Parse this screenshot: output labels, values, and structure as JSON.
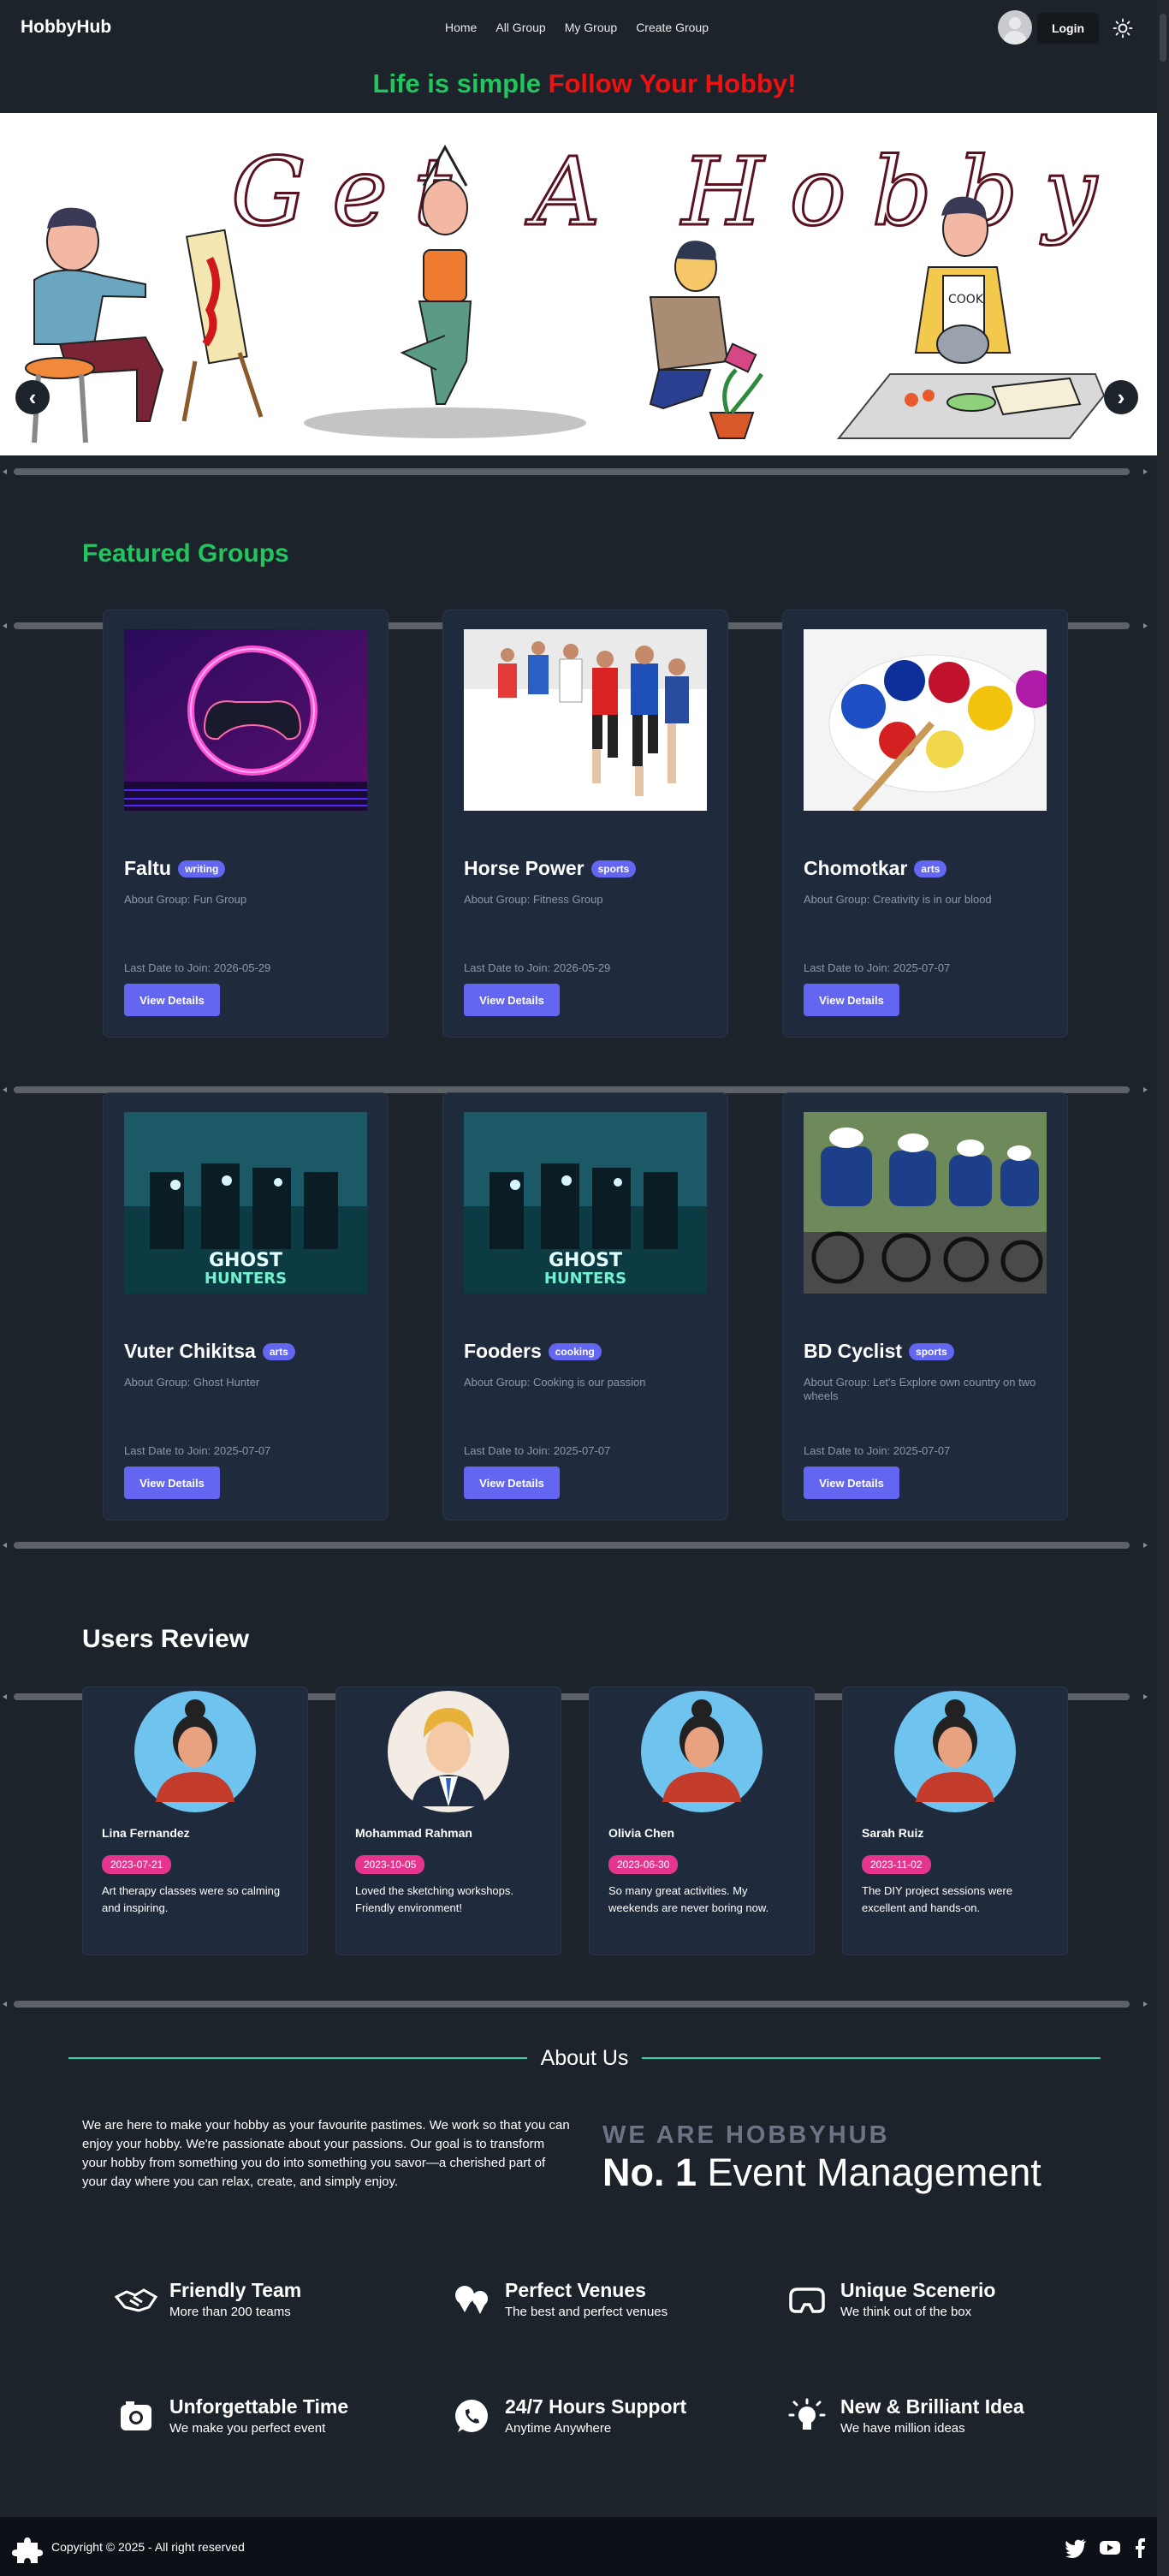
{
  "navbar": {
    "brand": "HobbyHub",
    "links": [
      "Home",
      "All Group",
      "My Group",
      "Create Group"
    ],
    "login_label": "Login"
  },
  "tagline": {
    "part1": "Life is simple",
    "part2": "Follow Your Hobby!"
  },
  "hero": {
    "banner_text": "Get A Hobby",
    "cook_label": "COOK",
    "prev_label": "‹",
    "next_label": "›"
  },
  "featured": {
    "title": "Featured Groups",
    "groups": [
      {
        "name": "Faltu",
        "category": "writing",
        "about": "About Group: Fun Group",
        "last_date": "Last Date to Join: 2026-05-29",
        "button": "View Details",
        "image": "gaming-neon-ring"
      },
      {
        "name": "Horse Power",
        "category": "sports",
        "about": "About Group: Fitness Group",
        "last_date": "Last Date to Join: 2026-05-29",
        "button": "View Details",
        "image": "marathon-runners"
      },
      {
        "name": "Chomotkar",
        "category": "arts",
        "about": "About Group: Creativity is in our blood",
        "last_date": "Last Date to Join: 2025-07-07",
        "button": "View Details",
        "image": "paint-palette"
      },
      {
        "name": "Vuter Chikitsa",
        "category": "arts",
        "about": "About Group: Ghost Hunter",
        "last_date": "Last Date to Join: 2025-07-07",
        "button": "View Details",
        "image": "ghost-hunters-poster"
      },
      {
        "name": "Fooders",
        "category": "cooking",
        "about": "About Group: Cooking is our passion",
        "last_date": "Last Date to Join: 2025-07-07",
        "button": "View Details",
        "image": "ghost-hunters-poster"
      },
      {
        "name": "BD Cyclist",
        "category": "sports",
        "about": "About Group: Let's Explore own country on two wheels",
        "last_date": "Last Date to Join: 2025-07-07",
        "button": "View Details",
        "image": "cyclists-race"
      }
    ]
  },
  "poster_text": {
    "line1": "GHOST",
    "line2": "HUNTERS"
  },
  "reviews": {
    "title": "Users Review",
    "items": [
      {
        "name": "Lina Fernandez",
        "date": "2023-07-21",
        "text": "Art therapy classes were so calming and inspiring.",
        "avatar": "woman-avatar"
      },
      {
        "name": "Mohammad Rahman",
        "date": "2023-10-05",
        "text": "Loved the sketching workshops. Friendly environment!",
        "avatar": "man-avatar"
      },
      {
        "name": "Olivia Chen",
        "date": "2023-06-30",
        "text": "So many great activities. My weekends are never boring now.",
        "avatar": "woman-avatar"
      },
      {
        "name": "Sarah Ruiz",
        "date": "2023-11-02",
        "text": "The DIY project sessions were excellent and hands-on.",
        "avatar": "woman-avatar"
      }
    ]
  },
  "about": {
    "title": "About Us",
    "text": "We are here to make your hobby as your favourite pastimes. We work so that you can enjoy your hobby. We're passionate about your passions. Our goal is to transform your hobby from something you do into something you savor—a cherished part of your day where you can relax, create, and simply enjoy.",
    "we_are": "WE ARE HOBBYHUB",
    "no1_bold": "No. 1",
    "no1_rest": "Event Management"
  },
  "features": [
    {
      "title": "Friendly Team",
      "sub": "More than 200 teams",
      "icon": "handshake-icon"
    },
    {
      "title": "Perfect Venues",
      "sub": "The best and perfect venues",
      "icon": "map-pins-icon"
    },
    {
      "title": "Unique Scenerio",
      "sub": "We think out of the box",
      "icon": "vr-headset-icon"
    },
    {
      "title": "Unforgettable Time",
      "sub": "We make you perfect event",
      "icon": "camera-icon"
    },
    {
      "title": "24/7 Hours Support",
      "sub": "Anytime Anywhere",
      "icon": "whatsapp-icon"
    },
    {
      "title": "New & Brilliant Idea",
      "sub": "We have million ideas",
      "icon": "lightbulb-icon"
    }
  ],
  "footer": {
    "copyright": "Copyright © 2025 - All right reserved",
    "social": [
      "twitter-icon",
      "youtube-icon",
      "facebook-icon"
    ]
  },
  "colors": {
    "accent": "#6366f1",
    "green": "#22c55e",
    "red": "#ef1010",
    "pink": "#e6358f",
    "bg": "#1d232a",
    "card": "#1f2a3c",
    "footer": "#0d1017"
  }
}
